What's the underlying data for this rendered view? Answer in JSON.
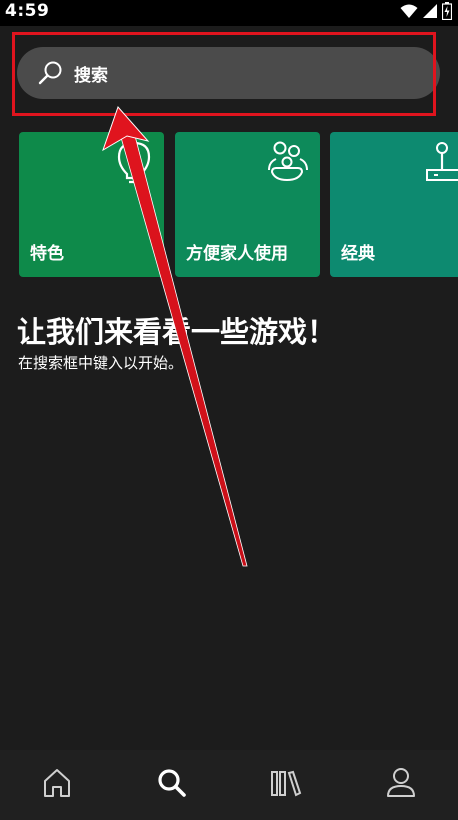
{
  "status_bar": {
    "time": "4:59",
    "icons": [
      "wifi-icon",
      "signal-icon",
      "battery-icon"
    ]
  },
  "search": {
    "placeholder": "搜索",
    "icon": "search-icon",
    "highlight_color": "#e0141e"
  },
  "categories": [
    {
      "label": "特色",
      "icon": "lightbulb-icon",
      "color": "#0e8a4a"
    },
    {
      "label": "方便家人使用",
      "icon": "family-icon",
      "color": "#0d8a5a"
    },
    {
      "label": "经典",
      "icon": "joystick-icon",
      "color": "#0d8a70"
    }
  ],
  "main": {
    "heading": "让我们来看看一些游戏！",
    "subheading": "在搜索框中键入以开始。"
  },
  "bottom_nav": {
    "items": [
      {
        "name": "home",
        "icon": "home-icon",
        "active": false
      },
      {
        "name": "search",
        "icon": "search-icon",
        "active": true
      },
      {
        "name": "library",
        "icon": "library-icon",
        "active": false
      },
      {
        "name": "profile",
        "icon": "profile-icon",
        "active": false
      }
    ]
  },
  "annotation": {
    "type": "arrow",
    "color": "#e0141e"
  }
}
